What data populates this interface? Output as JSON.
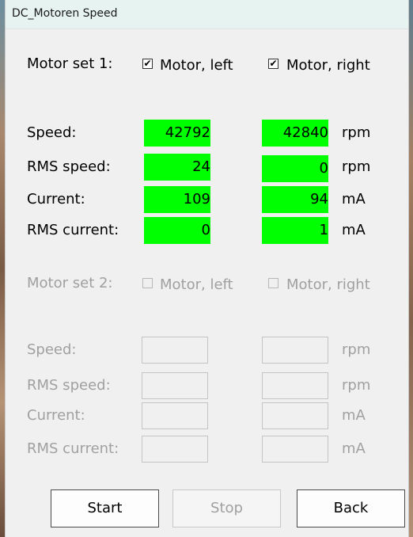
{
  "window": {
    "title": "DC_Motoren Speed"
  },
  "set1": {
    "label": "Motor set 1:",
    "left": {
      "label": "Motor, left",
      "checked": true
    },
    "right": {
      "label": "Motor, right",
      "checked": true
    },
    "speed": {
      "label": "Speed:",
      "left": "42792",
      "right": "42840",
      "unit": "rpm"
    },
    "rms_speed": {
      "label": "RMS speed:",
      "left": "24",
      "right": "0",
      "unit": "rpm"
    },
    "current": {
      "label": "Current:",
      "left": "109",
      "right": "94",
      "unit": "mA"
    },
    "rms_current": {
      "label": "RMS current:",
      "left": "0",
      "right": "1",
      "unit": "mA"
    }
  },
  "set2": {
    "label": "Motor set 2:",
    "left": {
      "label": "Motor, left",
      "checked": false
    },
    "right": {
      "label": "Motor, right",
      "checked": false
    },
    "speed": {
      "label": "Speed:",
      "left": "",
      "right": "",
      "unit": "rpm"
    },
    "rms_speed": {
      "label": "RMS speed:",
      "left": "",
      "right": "",
      "unit": "rpm"
    },
    "current": {
      "label": "Current:",
      "left": "",
      "right": "",
      "unit": "mA"
    },
    "rms_current": {
      "label": "RMS current:",
      "left": "",
      "right": "",
      "unit": "mA"
    }
  },
  "buttons": {
    "start": "Start",
    "stop": "Stop",
    "back": "Back"
  },
  "colors": {
    "value_bg": "#00ff00",
    "disabled_text": "#a0a0a0",
    "titlebar_bg": "#e6f3f1"
  },
  "checkmark": "✔"
}
